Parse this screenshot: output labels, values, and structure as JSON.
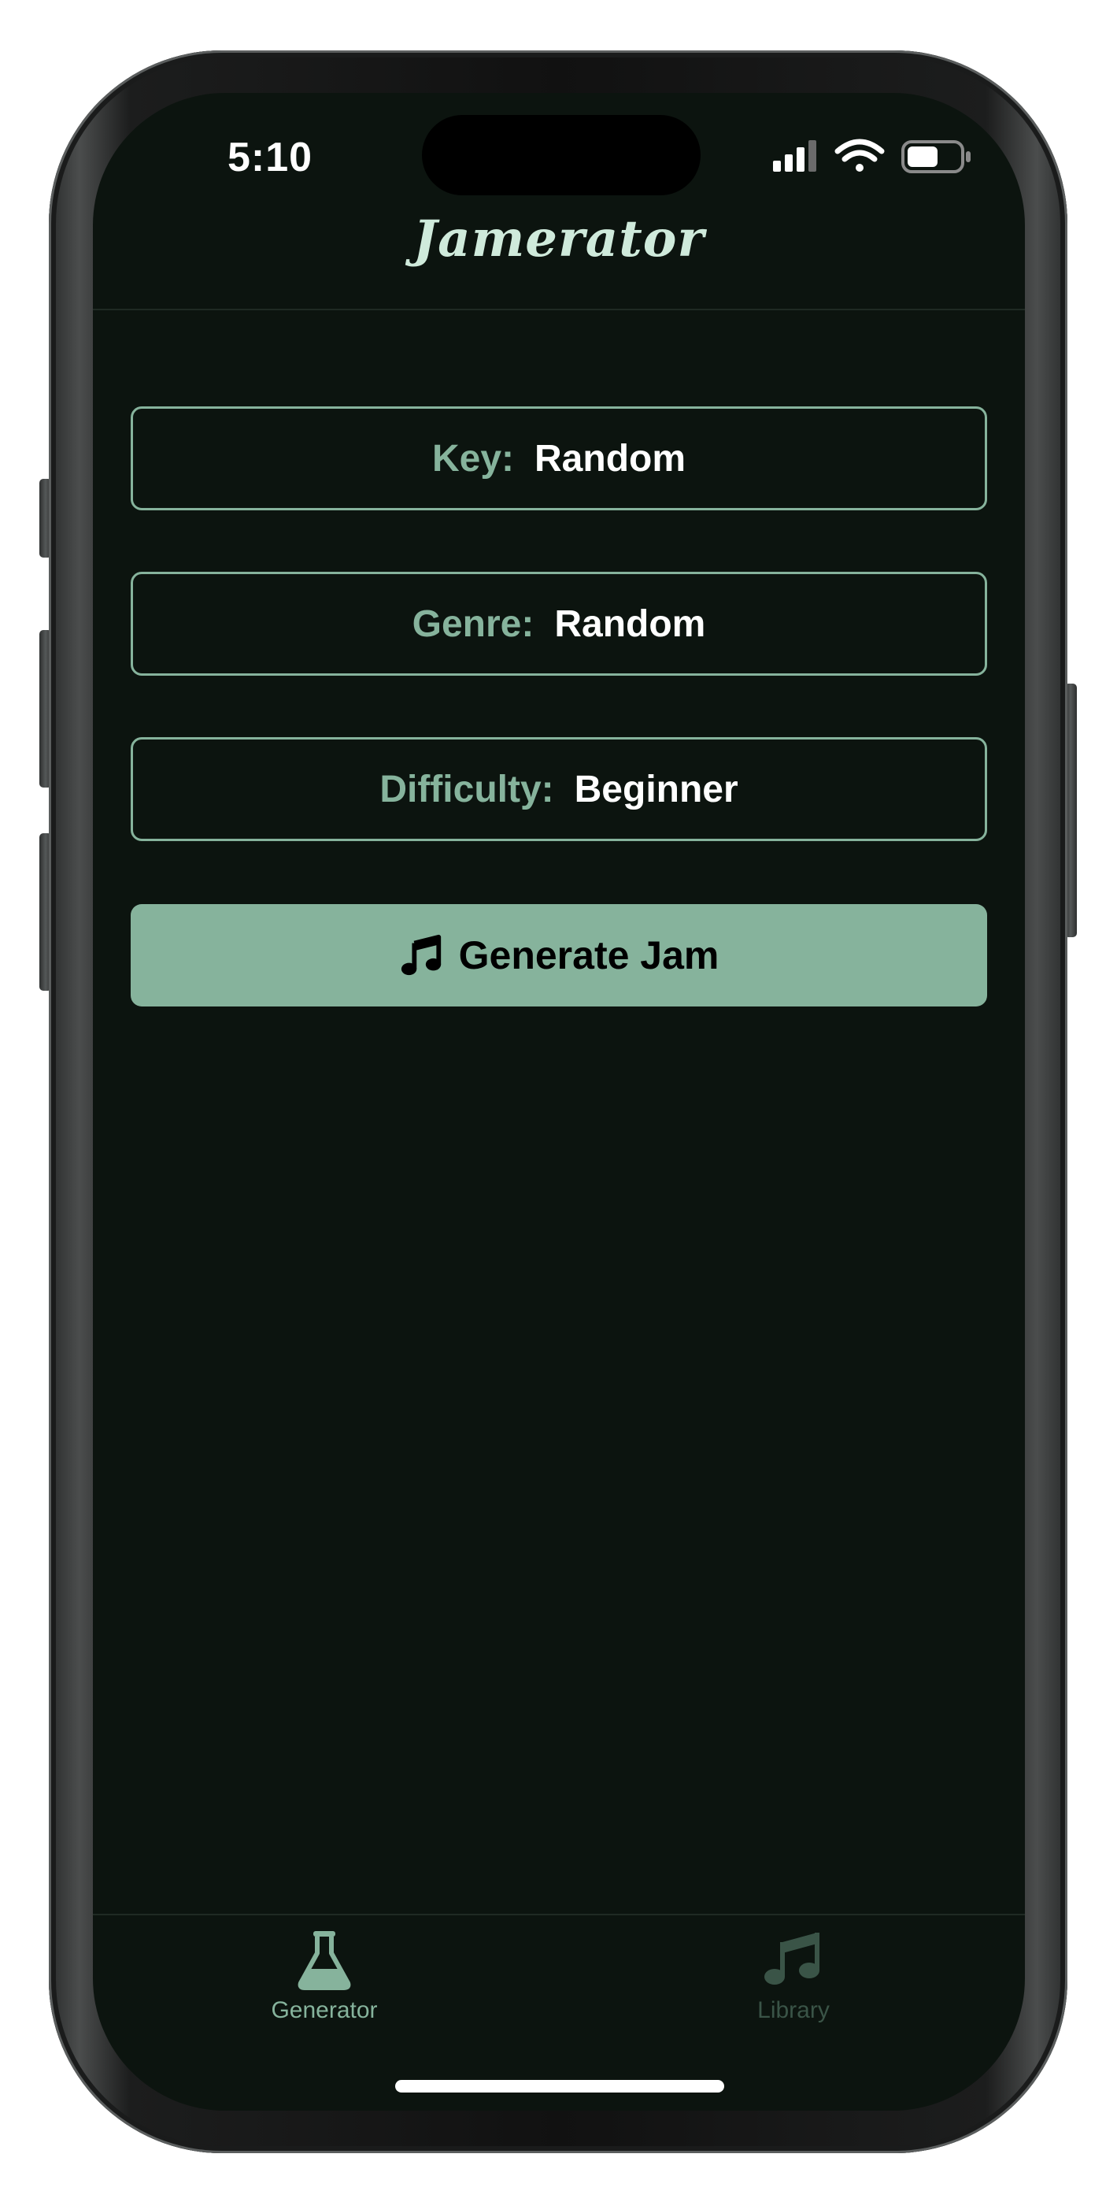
{
  "status_bar": {
    "time": "5:10",
    "icons": [
      "cellular-signal-icon",
      "wifi-icon",
      "battery-icon"
    ]
  },
  "nav": {
    "title": "Jamerator"
  },
  "options": {
    "key": {
      "label": "Key:",
      "value": "Random"
    },
    "genre": {
      "label": "Genre:",
      "value": "Random"
    },
    "difficulty": {
      "label": "Difficulty:",
      "value": "Beginner"
    }
  },
  "generate": {
    "label": "Generate Jam",
    "icon": "music-note-icon"
  },
  "tab_bar": {
    "active": "Generator",
    "tabs": [
      {
        "label": "Generator",
        "icon": "flask-icon"
      },
      {
        "label": "Library",
        "icon": "music-notes-icon"
      }
    ]
  },
  "colors": {
    "background": "#0c140f",
    "accent": "#86b39c",
    "title": "#cfeadb",
    "inactive_tab": "#3a5447",
    "text_primary": "#ffffff"
  }
}
